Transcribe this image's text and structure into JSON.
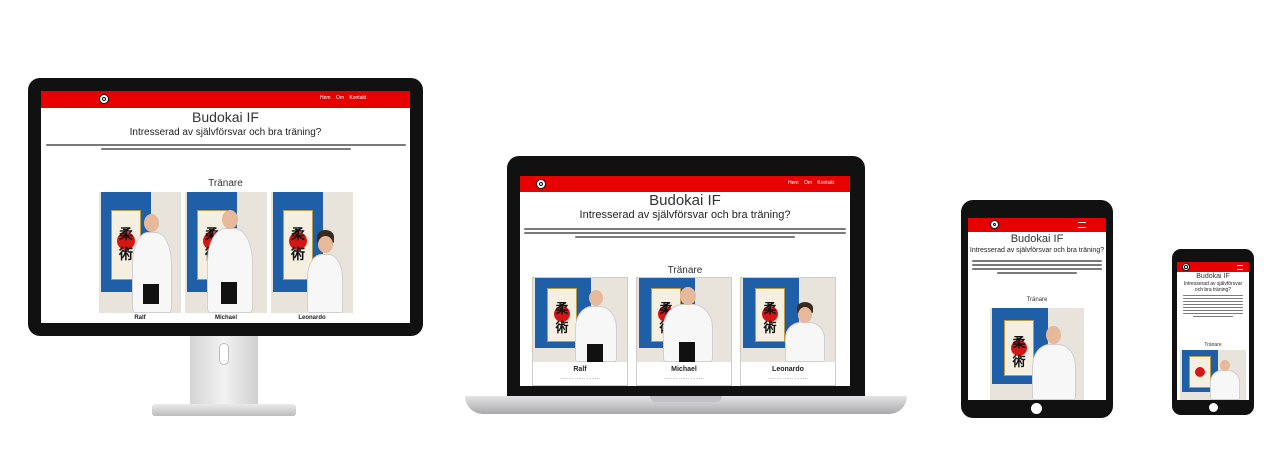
{
  "site": {
    "title": "Budokai IF",
    "tagline": "Intresserad av självförsvar och bra träning?",
    "tagline_short": "Intresserad av självförsvar och bra träning?",
    "section_heading": "Tränare",
    "nav_links": [
      "Hem",
      "Om",
      "Kontakt"
    ]
  },
  "trainers": [
    {
      "name": "Ralf",
      "note": "········ ······ ········"
    },
    {
      "name": "Michael",
      "note": "········ ······ ········"
    },
    {
      "name": "Leonardo",
      "note": "········ ······ ········"
    }
  ],
  "colors": {
    "brand_red": "#e60000",
    "flag_blue": "#1f5fa8",
    "sun_red": "#d41616",
    "device_black": "#111111",
    "laptop_silver": "#c9c9cc"
  },
  "icons": {
    "logo": "yin-yang-icon",
    "menu": "hamburger-menu-icon"
  }
}
